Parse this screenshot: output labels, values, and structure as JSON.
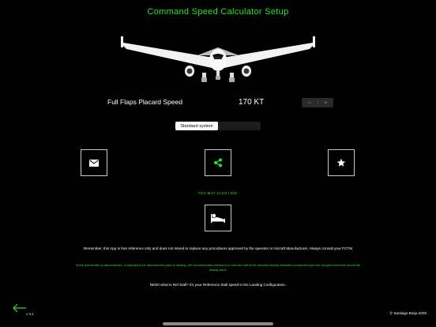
{
  "header": {
    "title": "Command Speed Calculator Setup"
  },
  "speed": {
    "label": "Full Flaps Placard Speed",
    "value": "170 KT",
    "decrement": "−",
    "increment": "+"
  },
  "system_selector": {
    "options": [
      "Standard system",
      ""
    ],
    "selected": "Standard system"
  },
  "actions": {
    "mail_icon": "envelope-icon",
    "share_icon": "share-icon",
    "star_icon": "star-icon"
  },
  "also_like": {
    "label": "YOU MAY ALSO LIKE:",
    "app_icon": "sleeping-person-icon"
  },
  "footer": {
    "disclaimer": "Remember, this App is fore reference only and does not intend to replace any procedures approved by the operator or Aircraft Manufacturer. Always consult your FCTM",
    "note": "*If the Autothrottle is disconnected, or planned to be disconnected prior to landing, the recommended method is to add one half of the reported steady headwind component plus the full gust increment above the steady wind*",
    "new_info": "NEW! what is Ref Stall? it's your Reference Stall speed in the Landing Configuration.",
    "version": "V 9.3",
    "copyright": "© Santiago Borja 2020"
  },
  "colors": {
    "accent": "#27e62a",
    "background": "#000000",
    "text": "#ffffff"
  }
}
